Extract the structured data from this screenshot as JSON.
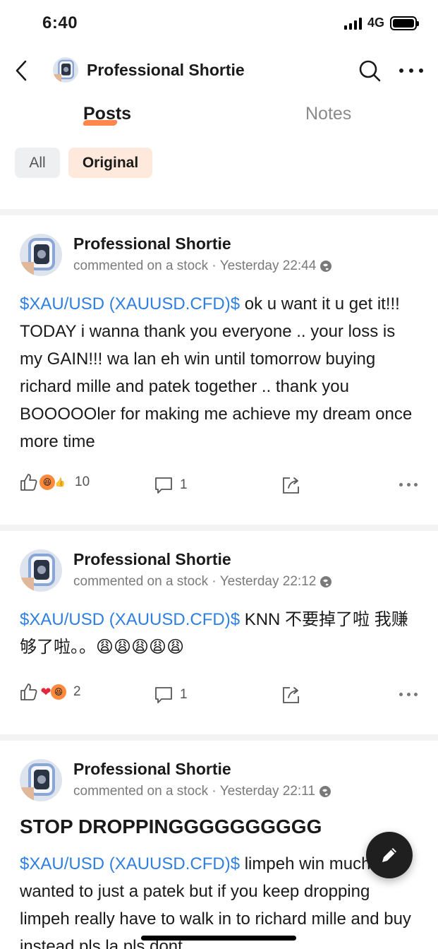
{
  "status_bar": {
    "time": "6:40",
    "network": "4G"
  },
  "nav": {
    "title": "Professional Shortie",
    "icons": [
      "back-icon",
      "search-icon",
      "more-icon"
    ]
  },
  "tabs": [
    {
      "label": "Posts",
      "active": true
    },
    {
      "label": "Notes",
      "active": false
    }
  ],
  "filters": [
    {
      "label": "All",
      "active": false
    },
    {
      "label": "Original",
      "active": true
    }
  ],
  "colors": {
    "ticker": "#2f7fe0",
    "accent": "#ff7a3a",
    "chip_active_bg": "#ffe9dc"
  },
  "posts": [
    {
      "author": "Professional Shortie",
      "meta": "commented on a stock · Yesterday 22:44",
      "ticker": "$XAU/USD (XAUUSD.CFD)$",
      "text": " ok u want it u get it!!! TODAY i wanna thank you everyone .. your loss is my GAIN!!!  wa lan eh win until tomorrow buying richard mille and patek together .. thank you BOOOOOler for making me achieve my dream once more time",
      "likes": "10",
      "comments": "1",
      "reactions": [
        "like-icon",
        "laugh-icon",
        "thumbs-up-icon"
      ]
    },
    {
      "author": "Professional Shortie",
      "meta": "commented on a stock · Yesterday 22:12",
      "ticker": "$XAU/USD (XAUUSD.CFD)$",
      "text": " KNN 不要掉了啦 我赚够了啦。。😩😩😩😩😩",
      "likes": "2",
      "comments": "1",
      "reactions": [
        "like-icon",
        "heart-icon",
        "laugh-icon"
      ]
    },
    {
      "author": "Professional Shortie",
      "meta": "commented on a stock · Yesterday 22:11",
      "heading": "STOP DROPPINGGGGGGGGGG",
      "ticker": "$XAU/USD (XAUUSD.CFD)$",
      "text": " limpeh win much i wanted to just a patek but if you keep dropping limpeh really have to walk in to richard mille and buy instead pls la pls dont"
    }
  ]
}
